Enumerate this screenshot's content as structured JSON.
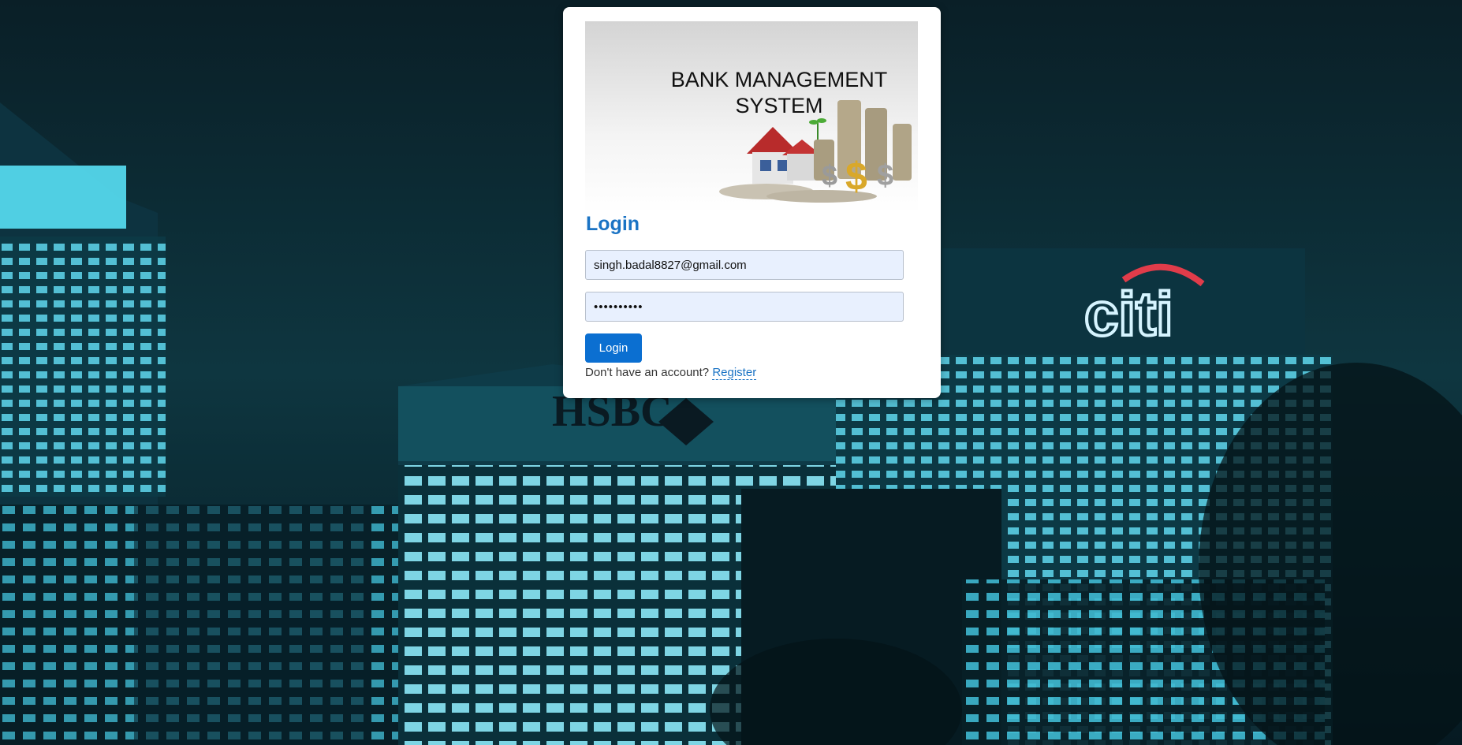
{
  "colors": {
    "accent": "#0b6fd1",
    "title": "#1a73c4",
    "input_bg": "#e8f0fe",
    "background_night": "#0b2a34"
  },
  "background": {
    "signs": [
      "HSBC",
      "citi"
    ]
  },
  "banner": {
    "line1": "BANK MANAGEMENT",
    "line2": "SYSTEM",
    "icon": "house-and-coins-illustration"
  },
  "login": {
    "title": "Login",
    "email_value": "singh.badal8827@gmail.com",
    "password_value": "••••••••••",
    "button_label": "Login",
    "register_prompt": "Don't have an account?",
    "register_link": "Register"
  }
}
